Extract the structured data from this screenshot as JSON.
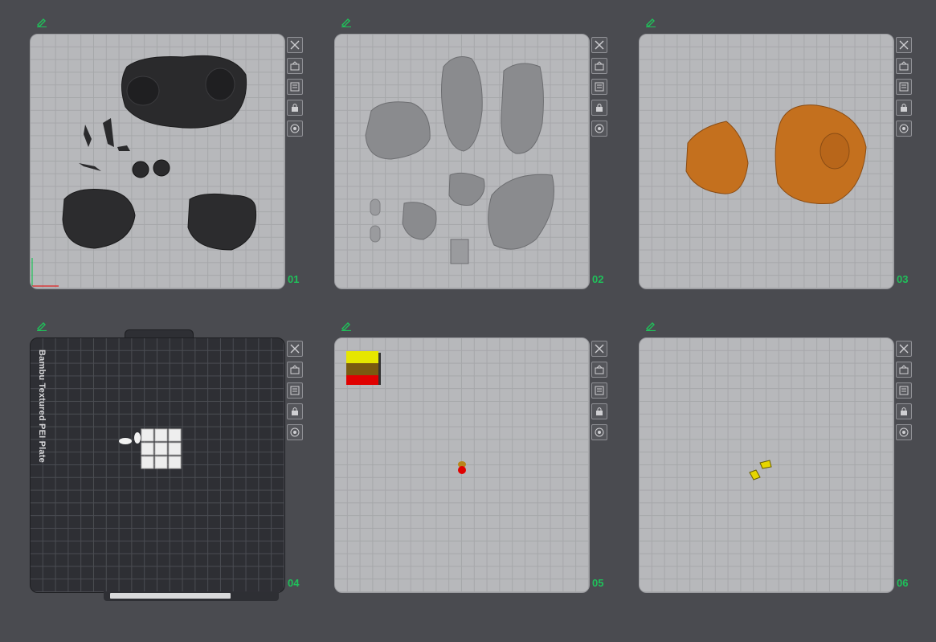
{
  "plates": [
    {
      "number": "01"
    },
    {
      "number": "02"
    },
    {
      "number": "03"
    },
    {
      "number": "04",
      "label": "Bambu Textured PEI Plate"
    },
    {
      "number": "05"
    },
    {
      "number": "06"
    }
  ],
  "tool_icons": [
    "close-icon",
    "auto-arrange-icon",
    "orient-icon",
    "lock-icon",
    "settings-icon"
  ],
  "colors": {
    "accent": "#1fc15a",
    "background": "#4a4b50",
    "model_orange": "#c4701e",
    "model_gray": "#8a8b8e",
    "model_black": "#2c2c2e"
  }
}
